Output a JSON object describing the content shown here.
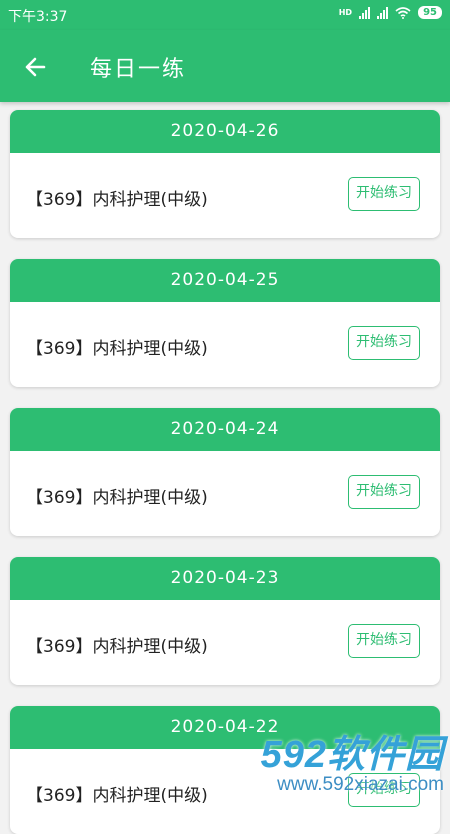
{
  "status_bar": {
    "time": "下午3:37",
    "hd": "HD",
    "battery": "95"
  },
  "header": {
    "title": "每日一练"
  },
  "cards": [
    {
      "date": "2020-04-26",
      "course": "【369】内科护理(中级)",
      "button": "开始练习"
    },
    {
      "date": "2020-04-25",
      "course": "【369】内科护理(中级)",
      "button": "开始练习"
    },
    {
      "date": "2020-04-24",
      "course": "【369】内科护理(中级)",
      "button": "开始练习"
    },
    {
      "date": "2020-04-23",
      "course": "【369】内科护理(中级)",
      "button": "开始练习"
    },
    {
      "date": "2020-04-22",
      "course": "【369】内科护理(中级)",
      "button": "开始练习"
    }
  ],
  "watermark": {
    "brand": "592软件园",
    "url": "www.592xiazai.com"
  },
  "colors": {
    "primary": "#2dbd72",
    "background": "#f2f2f2"
  }
}
